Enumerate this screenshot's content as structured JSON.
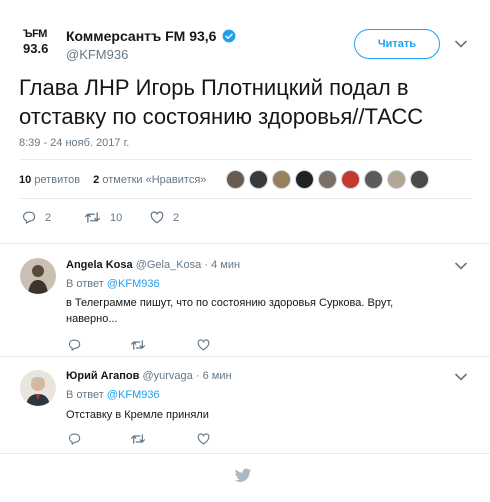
{
  "tweet": {
    "logo_line1": "ЪFM",
    "logo_line2": "93.6",
    "author_name": "Коммерсантъ FM 93,6",
    "author_handle": "@KFM936",
    "follow_label": "Читать",
    "text": "Глава ЛНР Игорь Плотницкий подал в отставку по состоянию здоровья//ТАСС",
    "timestamp": "8:39 - 24 нояб. 2017 г.",
    "retweets_count": "10",
    "retweets_label": "ретвитов",
    "likes_count": "2",
    "likes_label": "отметки «Нравится»",
    "liker_avatar_colors": [
      "#6b5a4e",
      "#3a3a3a",
      "#9a7f5e",
      "#222222",
      "#7a6f66",
      "#c23b2e",
      "#5b5b5b",
      "#b3a695",
      "#4a4a4a"
    ],
    "actions": {
      "reply": "2",
      "retweet": "10",
      "like": "2"
    },
    "accent_color": "#1da1f2"
  },
  "replies": [
    {
      "name": "Angela Kosa",
      "handle": "@Gela_Kosa",
      "time": "· 4 мин",
      "in_reply_prefix": "В ответ",
      "in_reply_to": "@KFM936",
      "text": "в Телеграмме пишут, что по состоянию здоровья Суркова. Врут, наверно..."
    },
    {
      "name": "Юрий Агапов",
      "handle": "@yurvaga",
      "time": "· 6 мин",
      "in_reply_prefix": "В ответ",
      "in_reply_to": "@KFM936",
      "text": "Отставку в Кремле приняли"
    }
  ],
  "icons": [
    "verified-icon",
    "chevron-down-icon",
    "reply-icon",
    "retweet-icon",
    "like-icon",
    "twitter-bird-icon"
  ]
}
